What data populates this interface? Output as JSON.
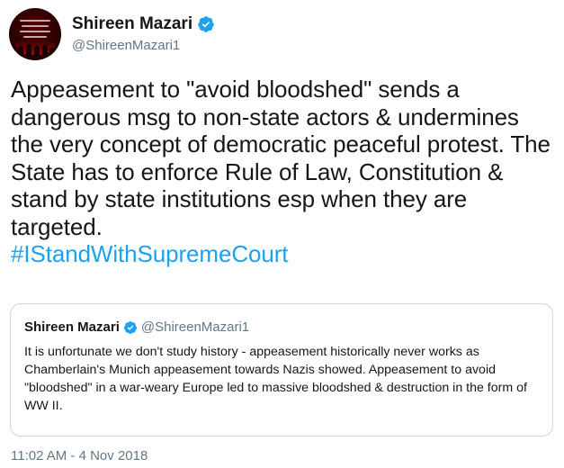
{
  "author": {
    "display_name": "Shireen Mazari",
    "handle": "@ShireenMazari1",
    "verified": true,
    "verified_color": "#1da1f2"
  },
  "tweet": {
    "text": "Appeasement to \"avoid bloodshed\" sends a dangerous msg to non-state actors & undermines the very concept of democratic peaceful protest. The State has to enforce Rule of Law, Constitution & stand by state institutions esp when they are targeted.",
    "hashtag": "#IStandWithSupremeCourt",
    "hashtag_color": "#1da1f2",
    "timestamp": "11:02 AM - 4 Nov 2018"
  },
  "quoted_tweet": {
    "display_name": "Shireen Mazari",
    "handle": "@ShireenMazari1",
    "verified": true,
    "text": "It is unfortunate we don't study history - appeasement historically never works as Chamberlain's Munich appeasement towards Nazis showed. Appeasement to avoid \"bloodshed\" in a war-weary Europe led to massive bloodshed & destruction in the form of WW II."
  },
  "icons": {
    "verified": "verified-badge-icon",
    "avatar": "profile-avatar"
  }
}
